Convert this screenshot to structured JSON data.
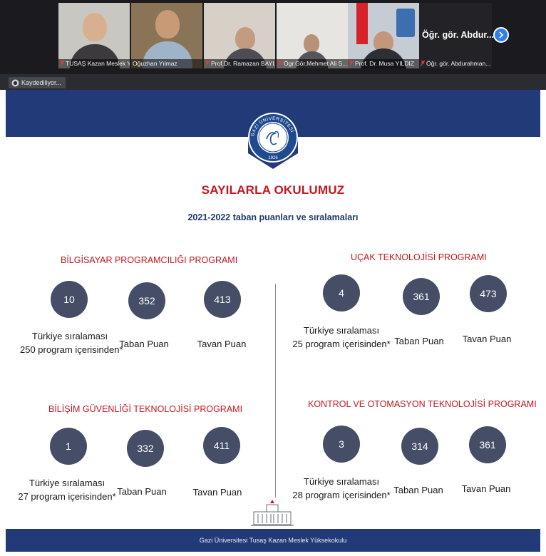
{
  "participants": [
    {
      "name": "TUSAŞ Kazan Meslek Y...",
      "muted": true
    },
    {
      "name": "Oğuzhan Yılmaz",
      "muted": false
    },
    {
      "name": "Prof.Dr. Ramazan BAYI...",
      "muted": true
    },
    {
      "name": "Ögr.Gör.Mehmet Ali S...",
      "muted": true
    },
    {
      "name": "Prof. Dr. Musa YILDIZ",
      "muted": true
    }
  ],
  "active_speaker": {
    "display": "Öğr. gör. Abdur...",
    "name": "Öğr. gör. Abdurahman..."
  },
  "recording_label": "Kaydediliyor...",
  "logo": {
    "university": "GAZİ ÜNİVERSİTESİ",
    "year": "1926",
    "script": "Gazi"
  },
  "slide": {
    "title": "SAYILARLA OKULUMUZ",
    "subtitle": "2021-2022 taban puanları ve sıralamaları",
    "programs": [
      {
        "title": "BİLGİSAYAR PROGRAMCILIĞI PROGRAMI",
        "rank": "10",
        "base": "352",
        "top": "413",
        "rank_label_1": "Türkiye sıralaması",
        "rank_label_2": "250 program içerisinden*",
        "base_label": "Taban Puan",
        "top_label": "Tavan Puan"
      },
      {
        "title": "UÇAK TEKNOLOJİSİ PROGRAMI",
        "rank": "4",
        "base": "361",
        "top": "473",
        "rank_label_1": "Türkiye sıralaması",
        "rank_label_2": "25 program içerisinden*",
        "base_label": "Taban Puan",
        "top_label": "Tavan Puan"
      },
      {
        "title": "BİLİŞİM GÜVENLİĞİ TEKNOLOJİSİ PROGRAMI",
        "rank": "1",
        "base": "332",
        "top": "411",
        "rank_label_1": "Türkiye sıralaması",
        "rank_label_2": "27 program içerisinden*",
        "base_label": "Taban Puan",
        "top_label": "Tavan Puan"
      },
      {
        "title": "KONTROL VE OTOMASYON TEKNOLOJİSİ PROGRAMI",
        "rank": "3",
        "base": "314",
        "top": "361",
        "rank_label_1": "Türkiye sıralaması",
        "rank_label_2": "28 program içerisinden*",
        "base_label": "Taban Puan",
        "top_label": "Tavan Puan"
      }
    ],
    "footer": "Gazi Üniversitesi Tusaş Kazan Meslek Yüksekokulu"
  },
  "colors": {
    "header_band": "#223b78",
    "accent_red": "#c4171d",
    "circle": "#454d67",
    "speaker_button": "#2d7ff0"
  }
}
